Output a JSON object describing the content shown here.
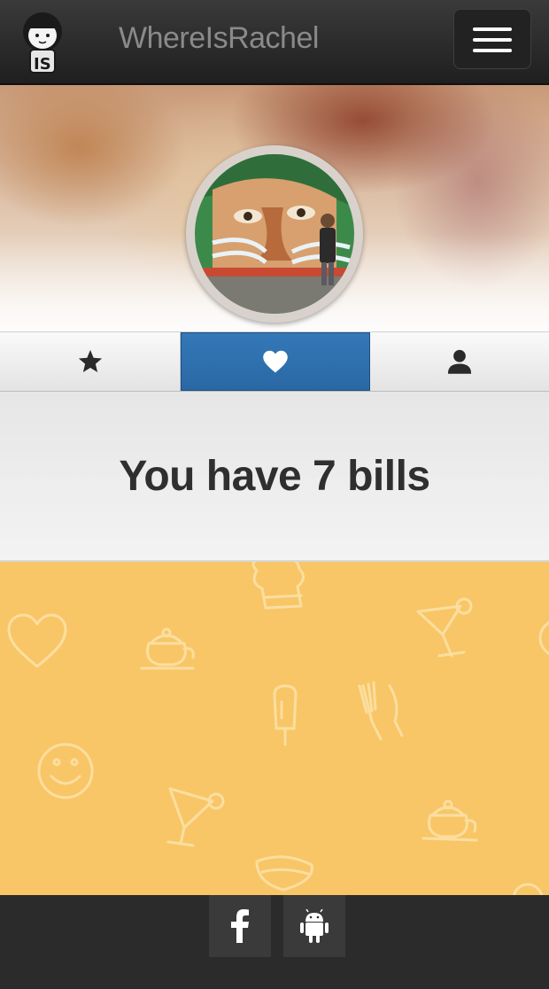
{
  "navbar": {
    "brand": "WhereIsRachel",
    "logo_icon": "girl-mascot-logo",
    "menu_icon": "hamburger-icon"
  },
  "profile": {
    "avatar_icon": "profile-photo-mural"
  },
  "tabs": [
    {
      "icon": "star-icon",
      "active": false
    },
    {
      "icon": "heart-icon",
      "active": true
    },
    {
      "icon": "user-icon",
      "active": false
    }
  ],
  "message": {
    "text": "You have 7 bills"
  },
  "footer": {
    "facebook_icon": "facebook-icon",
    "android_icon": "android-icon"
  },
  "colors": {
    "accent": "#2f6faf",
    "pattern_bg": "#f8c666",
    "navbar_bg": "#2a2a2a",
    "footer_bg": "#2b2b2b"
  }
}
